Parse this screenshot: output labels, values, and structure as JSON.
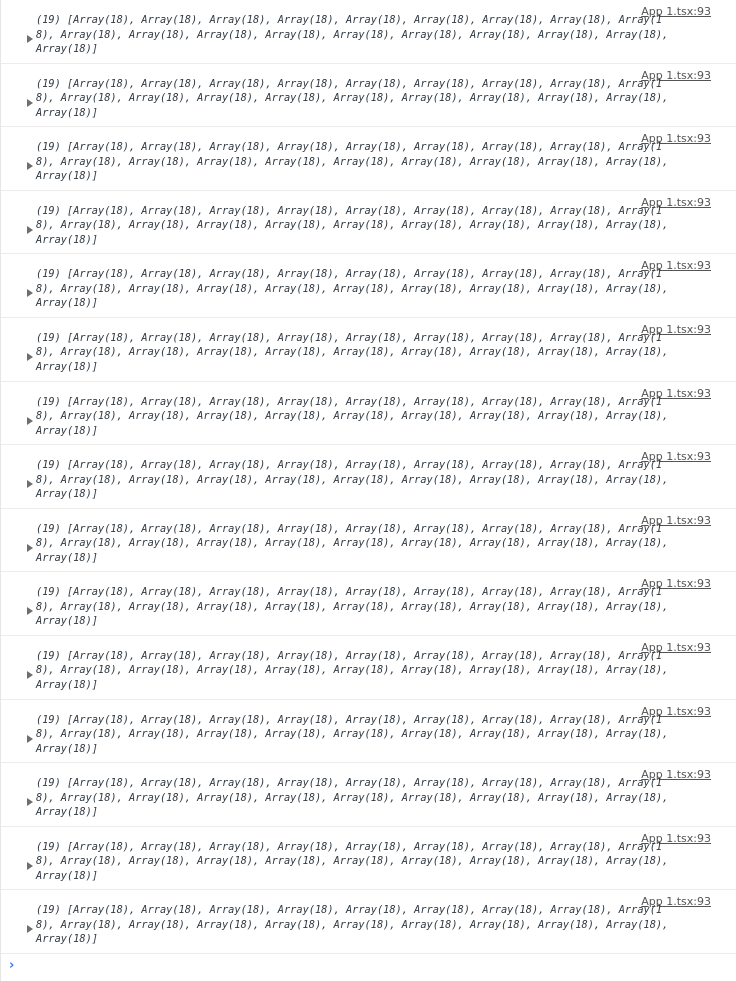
{
  "console": {
    "messages": [
      {
        "source": "App 1.tsx:93",
        "line1": "(19) [Array(18), Array(18), Array(18), Array(18), Array(18), Array(18), Array(18), Array(18), Array(1",
        "line2": "8), Array(18), Array(18), Array(18), Array(18), Array(18), Array(18), Array(18), Array(18), Array(18),",
        "line3": "Array(18)]"
      },
      {
        "source": "App 1.tsx:93",
        "line1": "(19) [Array(18), Array(18), Array(18), Array(18), Array(18), Array(18), Array(18), Array(18), Array(1",
        "line2": "8), Array(18), Array(18), Array(18), Array(18), Array(18), Array(18), Array(18), Array(18), Array(18),",
        "line3": "Array(18)]"
      },
      {
        "source": "App 1.tsx:93",
        "line1": "(19) [Array(18), Array(18), Array(18), Array(18), Array(18), Array(18), Array(18), Array(18), Array(1",
        "line2": "8), Array(18), Array(18), Array(18), Array(18), Array(18), Array(18), Array(18), Array(18), Array(18),",
        "line3": "Array(18)]"
      },
      {
        "source": "App 1.tsx:93",
        "line1": "(19) [Array(18), Array(18), Array(18), Array(18), Array(18), Array(18), Array(18), Array(18), Array(1",
        "line2": "8), Array(18), Array(18), Array(18), Array(18), Array(18), Array(18), Array(18), Array(18), Array(18),",
        "line3": "Array(18)]"
      },
      {
        "source": "App 1.tsx:93",
        "line1": "(19) [Array(18), Array(18), Array(18), Array(18), Array(18), Array(18), Array(18), Array(18), Array(1",
        "line2": "8), Array(18), Array(18), Array(18), Array(18), Array(18), Array(18), Array(18), Array(18), Array(18),",
        "line3": "Array(18)]"
      },
      {
        "source": "App 1.tsx:93",
        "line1": "(19) [Array(18), Array(18), Array(18), Array(18), Array(18), Array(18), Array(18), Array(18), Array(1",
        "line2": "8), Array(18), Array(18), Array(18), Array(18), Array(18), Array(18), Array(18), Array(18), Array(18),",
        "line3": "Array(18)]"
      },
      {
        "source": "App 1.tsx:93",
        "line1": "(19) [Array(18), Array(18), Array(18), Array(18), Array(18), Array(18), Array(18), Array(18), Array(1",
        "line2": "8), Array(18), Array(18), Array(18), Array(18), Array(18), Array(18), Array(18), Array(18), Array(18),",
        "line3": "Array(18)]"
      },
      {
        "source": "App 1.tsx:93",
        "line1": "(19) [Array(18), Array(18), Array(18), Array(18), Array(18), Array(18), Array(18), Array(18), Array(1",
        "line2": "8), Array(18), Array(18), Array(18), Array(18), Array(18), Array(18), Array(18), Array(18), Array(18),",
        "line3": "Array(18)]"
      },
      {
        "source": "App 1.tsx:93",
        "line1": "(19) [Array(18), Array(18), Array(18), Array(18), Array(18), Array(18), Array(18), Array(18), Array(1",
        "line2": "8), Array(18), Array(18), Array(18), Array(18), Array(18), Array(18), Array(18), Array(18), Array(18),",
        "line3": "Array(18)]"
      },
      {
        "source": "App 1.tsx:93",
        "line1": "(19) [Array(18), Array(18), Array(18), Array(18), Array(18), Array(18), Array(18), Array(18), Array(1",
        "line2": "8), Array(18), Array(18), Array(18), Array(18), Array(18), Array(18), Array(18), Array(18), Array(18),",
        "line3": "Array(18)]"
      },
      {
        "source": "App 1.tsx:93",
        "line1": "(19) [Array(18), Array(18), Array(18), Array(18), Array(18), Array(18), Array(18), Array(18), Array(1",
        "line2": "8), Array(18), Array(18), Array(18), Array(18), Array(18), Array(18), Array(18), Array(18), Array(18),",
        "line3": "Array(18)]"
      },
      {
        "source": "App 1.tsx:93",
        "line1": "(19) [Array(18), Array(18), Array(18), Array(18), Array(18), Array(18), Array(18), Array(18), Array(1",
        "line2": "8), Array(18), Array(18), Array(18), Array(18), Array(18), Array(18), Array(18), Array(18), Array(18),",
        "line3": "Array(18)]"
      },
      {
        "source": "App 1.tsx:93",
        "line1": "(19) [Array(18), Array(18), Array(18), Array(18), Array(18), Array(18), Array(18), Array(18), Array(1",
        "line2": "8), Array(18), Array(18), Array(18), Array(18), Array(18), Array(18), Array(18), Array(18), Array(18),",
        "line3": "Array(18)]"
      },
      {
        "source": "App 1.tsx:93",
        "line1": "(19) [Array(18), Array(18), Array(18), Array(18), Array(18), Array(18), Array(18), Array(18), Array(1",
        "line2": "8), Array(18), Array(18), Array(18), Array(18), Array(18), Array(18), Array(18), Array(18), Array(18),",
        "line3": "Array(18)]"
      },
      {
        "source": "App 1.tsx:93",
        "line1": "(19) [Array(18), Array(18), Array(18), Array(18), Array(18), Array(18), Array(18), Array(18), Array(1",
        "line2": "8), Array(18), Array(18), Array(18), Array(18), Array(18), Array(18), Array(18), Array(18), Array(18),",
        "line3": "Array(18)]"
      }
    ],
    "prompt_glyph": "›",
    "accent_color": "#367cf1"
  }
}
